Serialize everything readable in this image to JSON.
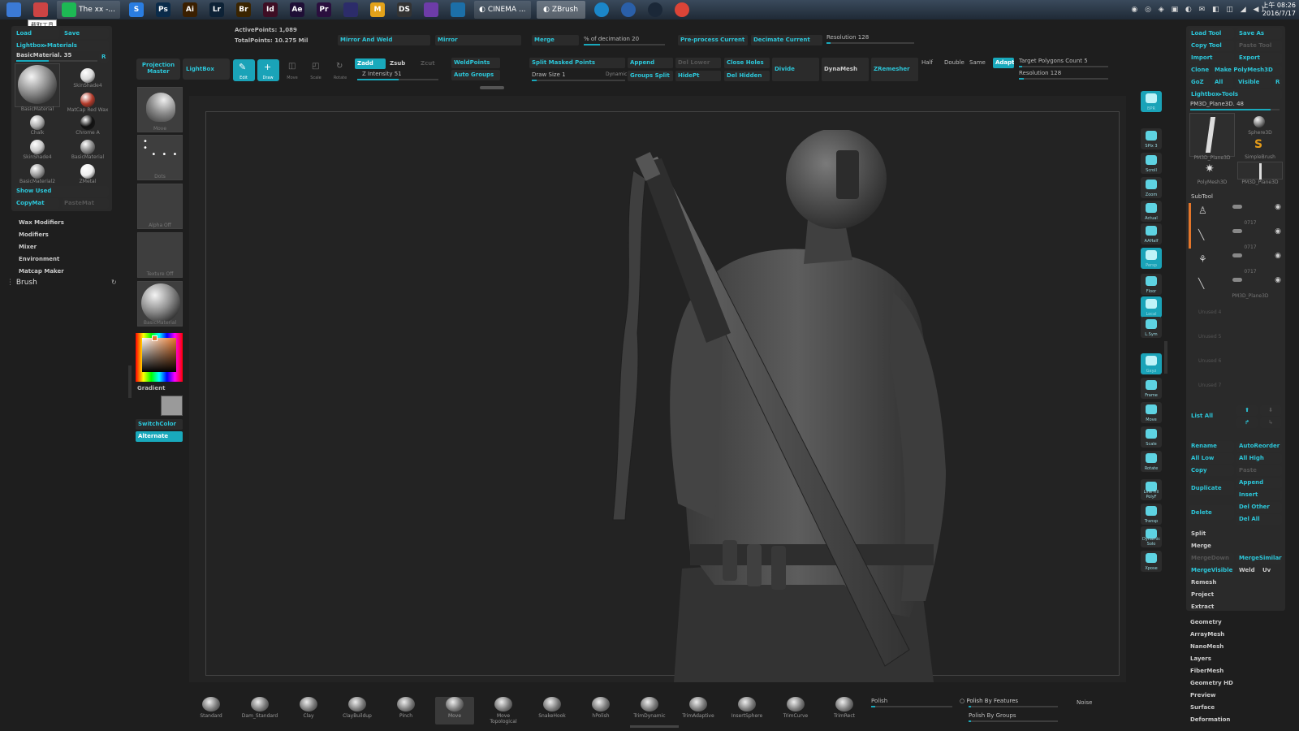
{
  "taskbar": {
    "apps": [
      {
        "label": "",
        "icon": "windows-start-icon",
        "color": "#3b7ad6"
      },
      {
        "label": "",
        "icon": "screenshot-tool-icon",
        "color": "#c44"
      },
      {
        "label": "The xx -...",
        "icon": "spotify-icon",
        "color": "#1db954"
      },
      {
        "label": "S",
        "icon": "app-s-icon",
        "color": "#2a7de1"
      },
      {
        "label": "Ps",
        "icon": "photoshop-icon",
        "color": "#0a2b4a"
      },
      {
        "label": "Ai",
        "icon": "illustrator-icon",
        "color": "#3a1f00"
      },
      {
        "label": "Lr",
        "icon": "lightroom-icon",
        "color": "#0d2236"
      },
      {
        "label": "Br",
        "icon": "bridge-icon",
        "color": "#3a2400"
      },
      {
        "label": "Id",
        "icon": "indesign-icon",
        "color": "#3e0e24"
      },
      {
        "label": "Ae",
        "icon": "after-effects-icon",
        "color": "#1f0f36"
      },
      {
        "label": "Pr",
        "icon": "premiere-icon",
        "color": "#2a0f3e"
      },
      {
        "label": "",
        "icon": "app-generic-icon",
        "color": "#2c2c6a"
      },
      {
        "label": "M",
        "icon": "app-m-icon",
        "color": "#e3a21a"
      },
      {
        "label": "DS",
        "icon": "ds-icon",
        "color": "#333"
      },
      {
        "label": "",
        "icon": "network-app-icon",
        "color": "#6d3ca8"
      },
      {
        "label": "",
        "icon": "blender-icon",
        "color": "#1c6fa8"
      }
    ],
    "windows": [
      {
        "label": "CINEMA ...",
        "icon": "cinema4d-icon"
      },
      {
        "label": "ZBrush",
        "icon": "zbrush-icon"
      }
    ],
    "apps2": [
      {
        "label": "",
        "icon": "qq-icon",
        "color": "#1b86c9"
      },
      {
        "label": "",
        "icon": "app-blue-icon",
        "color": "#2a5fa8"
      },
      {
        "label": "",
        "icon": "steam-icon",
        "color": "#1b2838"
      },
      {
        "label": "",
        "icon": "chrome-icon",
        "color": "#db4437"
      }
    ],
    "clock_time": "上午 08:26",
    "clock_date": "2016/7/17",
    "tooltip": "截取工具"
  },
  "left_palette": {
    "load": "Load",
    "save": "Save",
    "lightbox_materials": "Lightbox▸Materials",
    "current_material": "BasicMaterial. 35",
    "r_button": "R",
    "materials": [
      "SkinShade4",
      "MatCap Red Wax",
      "Chalk",
      "Chrome A",
      "SkinShade4",
      "BasicMaterial",
      "BasicMaterial2",
      "ZMetal"
    ],
    "big_material_label": "BasicMaterial",
    "show_used": "Show Used",
    "copymat": "CopyMat",
    "pastemat": "PasteMat",
    "menu": [
      "Wax Modifiers",
      "Modifiers",
      "Mixer",
      "Environment",
      "Matcap Maker"
    ],
    "brush": "Brush"
  },
  "left_shelf": {
    "projection_master": "Projection Master",
    "lightbox": "LightBox",
    "tiles": [
      "Move",
      "Dots",
      "Alpha Off",
      "Texture Off",
      "BasicMaterial"
    ],
    "gradient": "Gradient",
    "switchcolor": "SwitchColor",
    "alternate": "Alternate",
    "main_color": "#e4762a",
    "secondary_color": "#9a9a9a"
  },
  "top_shelf": {
    "active_points": "ActivePoints: 1,089",
    "total_points": "TotalPoints: 10.275 Mil",
    "mirror_and_weld": "Mirror And Weld",
    "mirror": "Mirror",
    "merge": "Merge",
    "decimation": "% of decimation 20",
    "preprocess": "Pre-process Current",
    "decimate_current": "Decimate Current",
    "resolution_top": "Resolution 128",
    "edit": "Edit",
    "draw": "Draw",
    "move": "Move",
    "scale": "Scale",
    "rotate": "Rotate",
    "zadd": "Zadd",
    "zsub": "Zsub",
    "zcut": "Zcut",
    "z_intensity": "Z Intensity 51",
    "draw_size": "Draw Size 1",
    "dynamic": "Dynamic",
    "weldpoints": "WeldPoints",
    "auto_groups": "Auto Groups",
    "split_masked": "Split Masked Points",
    "append": "Append",
    "del_lower": "Del Lower",
    "groups_split": "Groups Split",
    "hidept": "HidePt",
    "close_holes": "Close Holes",
    "del_hidden": "Del Hidden",
    "divide": "Divide",
    "dynamesh": "DynaMesh",
    "zremesher": "ZRemesher",
    "half": "Half",
    "double": "Double",
    "same": "Same",
    "adapt": "Adapt",
    "target_polygons": "Target Polygons Count 5",
    "resolution": "Resolution 128"
  },
  "right_nav": [
    "BPR",
    "SPix 3",
    "Scroll",
    "Zoom",
    "Actual",
    "AAHalf",
    "Persp",
    "Floor",
    "Local",
    "L.Sym",
    "Gxyz",
    "Frame",
    "Move",
    "Scale",
    "Rotate",
    "Line Fill PolyF",
    "Transp",
    "Dynamic Solo",
    "Xpose"
  ],
  "tool_palette": {
    "load_tool": "Load Tool",
    "save_as": "Save As",
    "copy_tool": "Copy Tool",
    "paste_tool": "Paste Tool",
    "import": "Import",
    "export": "Export",
    "clone": "Clone",
    "make_polymesh": "Make PolyMesh3D",
    "goz": "GoZ",
    "all": "All",
    "visible": "Visible",
    "r": "R",
    "lightbox_tools": "Lightbox▸Tools",
    "current_tool": "PM3D_Plane3D. 48",
    "thumbs": [
      "PM3D_Plane3D",
      "Sphere3D",
      "SimpleBrush",
      "PolyMesh3D",
      "PM3D_Plane3D"
    ],
    "subtool_header": "SubTool",
    "subtools": [
      "0717",
      "0717",
      "0717",
      "PM3D_Plane3D"
    ],
    "unused": [
      "Unused 4",
      "Unused 5",
      "Unused 6",
      "Unused 7"
    ],
    "list_all": "List All",
    "rename": "Rename",
    "autoreorder": "AutoReorder",
    "all_low": "All Low",
    "all_high": "All High",
    "copy": "Copy",
    "paste": "Paste",
    "duplicate": "Duplicate",
    "append": "Append",
    "insert": "Insert",
    "delete": "Delete",
    "del_other": "Del Other",
    "del_all": "Del All",
    "split": "Split",
    "merge": "Merge",
    "mergedown": "MergeDown",
    "mergesimilar": "MergeSimilar",
    "mergevisible": "MergeVisible",
    "weld": "Weld",
    "uv": "Uv",
    "remesh": "Remesh",
    "project": "Project",
    "extract": "Extract",
    "menu": [
      "Geometry",
      "ArrayMesh",
      "NanoMesh",
      "Layers",
      "FiberMesh",
      "Geometry HD",
      "Preview",
      "Surface",
      "Deformation"
    ]
  },
  "brush_shelf": {
    "brushes": [
      "Standard",
      "Dam_Standard",
      "Clay",
      "ClayBuildup",
      "Pinch",
      "Move",
      "Move Topological",
      "SnakeHook",
      "hPolish",
      "TrimDynamic",
      "TrimAdaptive",
      "InsertSphere",
      "TrimCurve",
      "TrimRect"
    ],
    "polish": "Polish",
    "polish_by_features": "Polish By Features",
    "polish_by_groups": "Polish By Groups",
    "noise": "Noise"
  },
  "colors": {
    "accent": "#19a9bc",
    "canvas_bg": "#262626",
    "ui_bg": "#1e1e1e",
    "highlight_orange": "#e4762a"
  }
}
